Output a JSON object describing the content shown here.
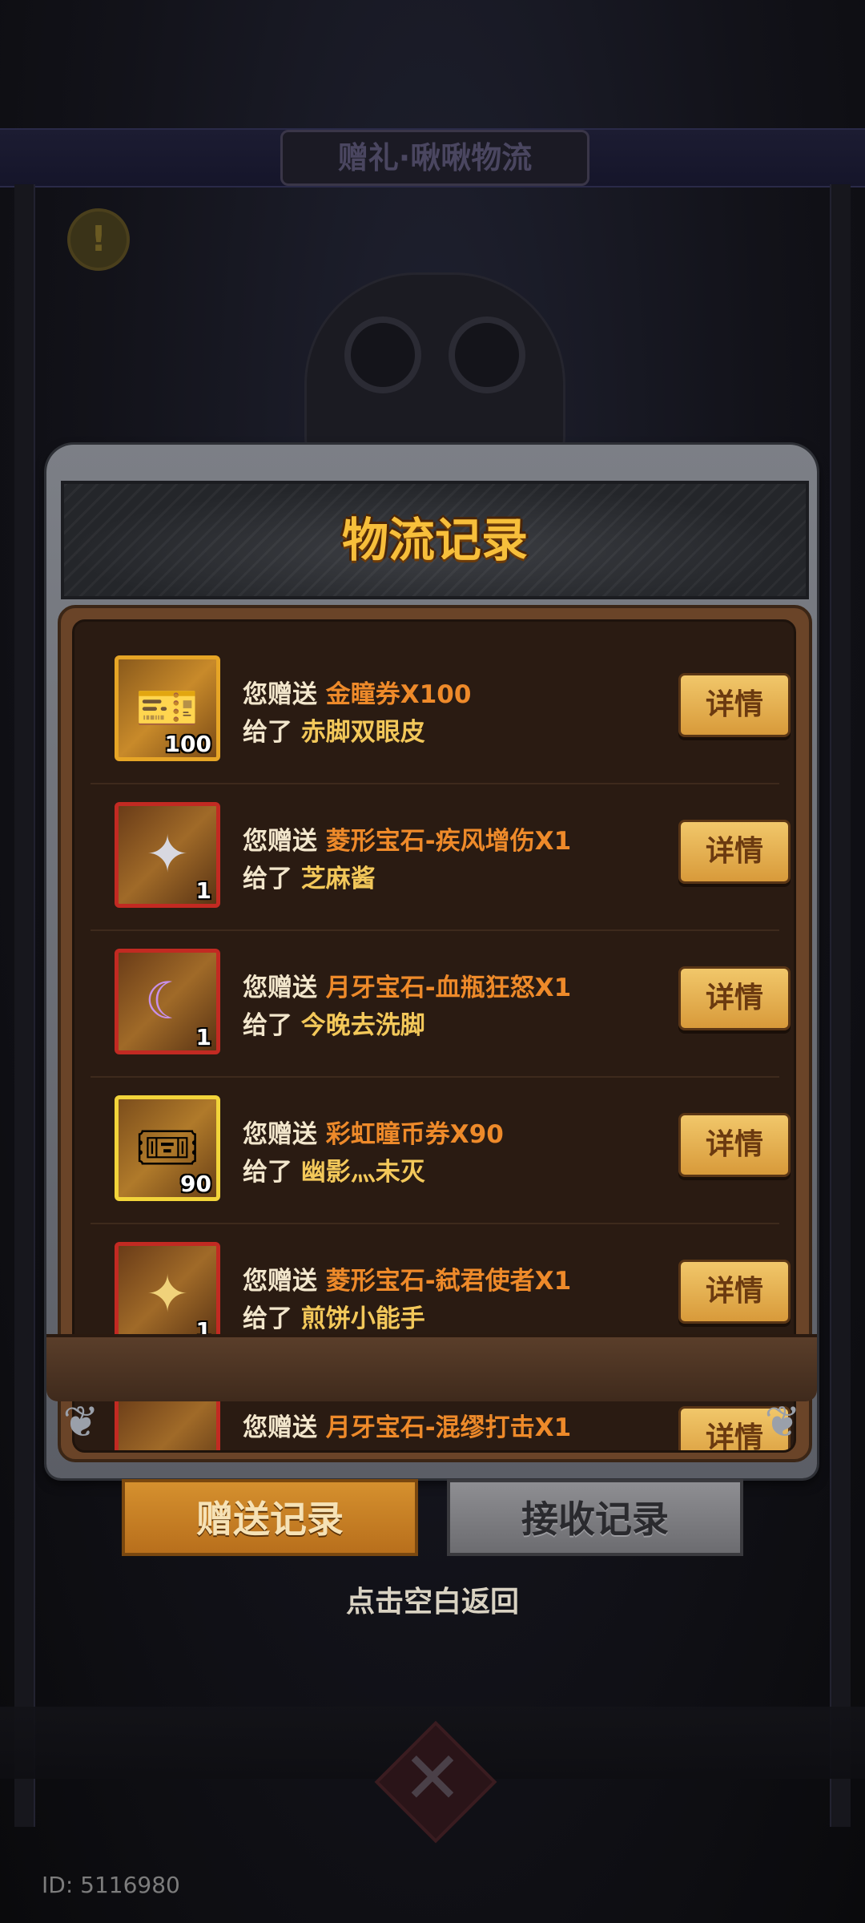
{
  "background": {
    "title": "赠礼·啾啾物流",
    "warning_glyph": "!"
  },
  "dialog": {
    "title": "物流记录",
    "send_prefix": "您赠送",
    "to_prefix": "给了",
    "detail_label": "详情",
    "records": [
      {
        "item": "金瞳券X100",
        "recipient": "赤脚双眼皮",
        "qty": "100",
        "icon": "golden-ticket-icon",
        "frame": "gold",
        "glyph": "🎫"
      },
      {
        "item": "菱形宝石-疾风增伤X1",
        "recipient": "芝麻酱",
        "qty": "1",
        "icon": "diamond-gem-icon",
        "frame": "red",
        "glyph": "✦"
      },
      {
        "item": "月牙宝石-血瓶狂怒X1",
        "recipient": "今晚去洗脚",
        "qty": "1",
        "icon": "crescent-gem-icon",
        "frame": "red",
        "glyph": "☾"
      },
      {
        "item": "彩虹瞳币券X90",
        "recipient": "幽影灬未灭",
        "qty": "90",
        "icon": "rainbow-ticket-icon",
        "frame": "yellow",
        "glyph": "🎟"
      },
      {
        "item": "菱形宝石-弑君使者X1",
        "recipient": "煎饼小能手",
        "qty": "1",
        "icon": "diamond-gem-icon",
        "frame": "red",
        "glyph": "✦"
      }
    ],
    "partial_record": {
      "prefix": "您赠送",
      "item": "月牙宝石-混缪打击X1"
    }
  },
  "tabs": {
    "send": "赠送记录",
    "receive": "接收记录"
  },
  "return_hint": "点击空白返回",
  "user_id": "ID: 5116980",
  "colors": {
    "item_name": "#ee8a2a",
    "recipient": "#f3c85a",
    "title": "#f7bf3b"
  }
}
